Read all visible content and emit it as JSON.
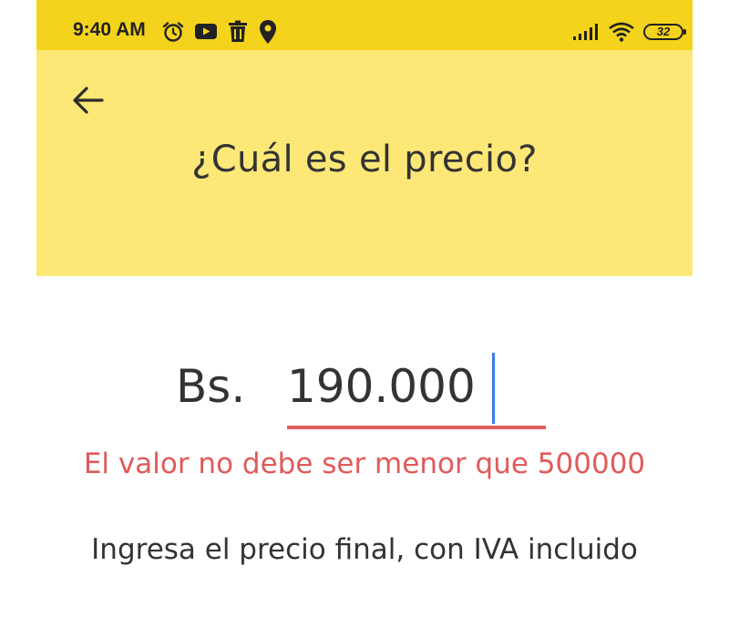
{
  "status_bar": {
    "time": "9:40 AM",
    "battery_level": "32",
    "left_icons": [
      "alarm-icon",
      "youtube-icon",
      "trash-icon",
      "location-pin-icon"
    ],
    "right_icons": [
      "signal-icon",
      "wifi-icon",
      "battery-icon"
    ],
    "background_color": "#f3d31b"
  },
  "header": {
    "title": "¿Cuál es el precio?",
    "back_icon": "arrow-left-icon",
    "background_color": "#fde877"
  },
  "price_field": {
    "currency": "Bs.",
    "value": "190.000",
    "underline_color": "#e05f5f",
    "caret_color": "#3a7cf3"
  },
  "validation": {
    "error_message": "El valor no debe ser menor que 500000",
    "error_color": "#e05a5a"
  },
  "helper": {
    "text": "Ingresa el precio final, con IVA incluido"
  }
}
